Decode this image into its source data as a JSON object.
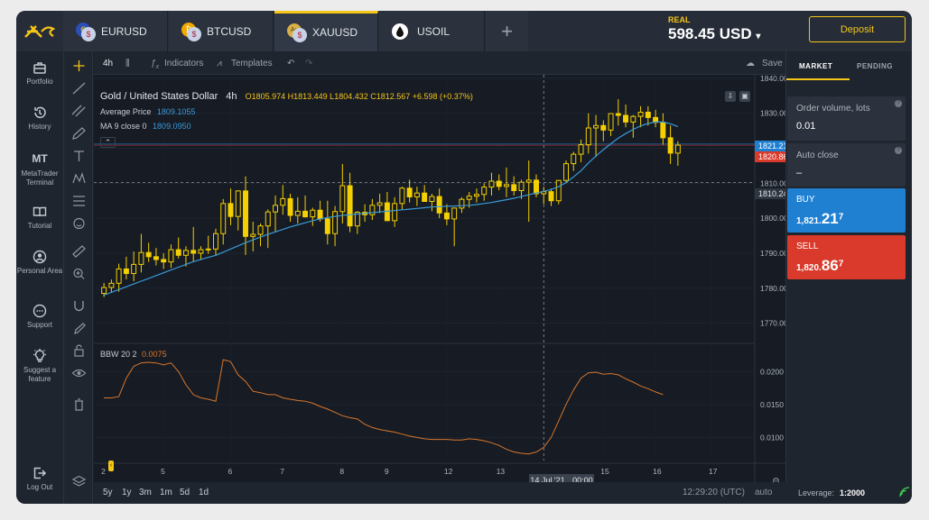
{
  "tabs": [
    {
      "symbol": "EURUSD",
      "flag1": "€",
      "flag2": "$"
    },
    {
      "symbol": "BTCUSD",
      "flag1": "₿",
      "flag2": "$"
    },
    {
      "symbol": "XAUUSD",
      "flag1": "Au",
      "flag2": "$"
    },
    {
      "symbol": "USOIL",
      "flag1": "",
      "flag2": ""
    }
  ],
  "add_tab": "+",
  "account": {
    "type": "REAL",
    "balance": "598.45 USD",
    "caret": "▾"
  },
  "deposit": "Deposit",
  "sidebar": [
    {
      "label": "Portfolio",
      "icon": "briefcase-icon"
    },
    {
      "label": "History",
      "icon": "history-icon"
    },
    {
      "label": "MetaTrader Terminal",
      "icon": "mt-icon",
      "glyph": "MT"
    },
    {
      "label": "Tutorial",
      "icon": "book-icon"
    },
    {
      "label": "Personal Area",
      "icon": "user-icon"
    },
    {
      "label": "Support",
      "icon": "chat-icon"
    },
    {
      "label": "Suggest a feature",
      "icon": "bulb-icon"
    },
    {
      "label": "Log Out",
      "icon": "logout-icon"
    }
  ],
  "toolbar": {
    "timeframe": "4h",
    "indicators": "Indicators",
    "templates": "Templates",
    "save": "Save"
  },
  "chart_info": {
    "title": "Gold / United States Dollar",
    "tf": "4h",
    "ohlc": "O1805.974 H1813.449 L1804.432 C1812.567 +6.598 (+0.37%)",
    "avg_label": "Average Price",
    "avg_value": "1809.1055",
    "ma_label": "MA 9 close 0",
    "ma_value": "1809.0950",
    "bbw_label": "BBW 20 2",
    "bbw_value": "0.0075"
  },
  "price_tags": {
    "ask": "1821.217",
    "bid": "1820.867",
    "cross": "1810.240"
  },
  "crosshair_date": "14 Jul '21",
  "crosshair_time": "00:00",
  "colors": {
    "up": "#f5d000",
    "down": "#f5d000",
    "ma": "#3a9ad9",
    "bbw": "#d9772b",
    "buy": "#1f7fd1",
    "sell": "#d93a2b",
    "accent": "#f5c518"
  },
  "chart_data": {
    "type": "line",
    "symbol": "XAUUSD",
    "timeframe": "4h",
    "price_axis": [
      1840,
      1830,
      1820,
      1810,
      1800,
      1790,
      1780,
      1770
    ],
    "price_axis_labels": [
      "1840.000",
      "1830.000",
      "1820.000",
      "1810.000",
      "1800.000",
      "1790.000",
      "1780.000",
      "1770.000"
    ],
    "bbw_axis": [
      0.02,
      0.015,
      0.01
    ],
    "bbw_axis_labels": [
      "0.0200",
      "0.0150",
      "0.0100"
    ],
    "x_labels": [
      "2",
      "5",
      "6",
      "7",
      "8",
      "9",
      "12",
      "13",
      "15",
      "16",
      "17"
    ],
    "ylim": [
      1765,
      1841
    ],
    "candles": [
      [
        1778.5,
        1781.5,
        1777.5,
        1780.2
      ],
      [
        1780.2,
        1782.5,
        1778.8,
        1781.4
      ],
      [
        1781.4,
        1787.0,
        1779.0,
        1785.5
      ],
      [
        1785.5,
        1789.0,
        1782.5,
        1784.2
      ],
      [
        1784.2,
        1790.5,
        1782.0,
        1786.8
      ],
      [
        1786.8,
        1795.5,
        1784.5,
        1790.2
      ],
      [
        1790.2,
        1793.0,
        1787.5,
        1789.0
      ],
      [
        1789.0,
        1791.5,
        1786.5,
        1788.2
      ],
      [
        1788.2,
        1790.0,
        1785.5,
        1787.5
      ],
      [
        1787.5,
        1792.5,
        1785.8,
        1791.0
      ],
      [
        1791.0,
        1794.5,
        1788.5,
        1789.4
      ],
      [
        1789.4,
        1792.0,
        1786.2,
        1790.8
      ],
      [
        1790.8,
        1797.5,
        1787.5,
        1790.0
      ],
      [
        1790.0,
        1792.0,
        1788.0,
        1791.0
      ],
      [
        1791.0,
        1795.0,
        1789.8,
        1791.2
      ],
      [
        1791.2,
        1797.0,
        1789.5,
        1795.6
      ],
      [
        1795.6,
        1805.5,
        1792.5,
        1804.2
      ],
      [
        1804.2,
        1808.5,
        1798.0,
        1800.5
      ],
      [
        1800.5,
        1808.0,
        1796.5,
        1807.8
      ],
      [
        1807.8,
        1812.0,
        1789.5,
        1794.8
      ],
      [
        1794.8,
        1799.0,
        1790.5,
        1795.4
      ],
      [
        1795.4,
        1798.5,
        1792.0,
        1797.8
      ],
      [
        1797.8,
        1802.5,
        1791.5,
        1801.8
      ],
      [
        1801.8,
        1806.5,
        1796.0,
        1803.7
      ],
      [
        1803.7,
        1809.5,
        1801.0,
        1805.6
      ],
      [
        1805.6,
        1807.0,
        1799.0,
        1800.8
      ],
      [
        1800.8,
        1806.0,
        1798.5,
        1802.0
      ],
      [
        1802.0,
        1806.5,
        1800.2,
        1800.4
      ],
      [
        1800.4,
        1803.0,
        1797.8,
        1802.3
      ],
      [
        1802.3,
        1805.0,
        1799.0,
        1799.8
      ],
      [
        1799.8,
        1805.0,
        1792.5,
        1795.6
      ],
      [
        1795.6,
        1803.5,
        1792.0,
        1801.9
      ],
      [
        1801.9,
        1815.5,
        1798.5,
        1809.3
      ],
      [
        1809.3,
        1813.0,
        1796.0,
        1797.8
      ],
      [
        1797.8,
        1802.0,
        1795.5,
        1801.7
      ],
      [
        1801.7,
        1804.0,
        1799.0,
        1801.0
      ],
      [
        1801.0,
        1805.5,
        1799.5,
        1803.7
      ],
      [
        1803.7,
        1807.0,
        1801.5,
        1804.4
      ],
      [
        1804.4,
        1807.5,
        1801.0,
        1799.3
      ],
      [
        1799.3,
        1806.0,
        1797.5,
        1804.2
      ],
      [
        1804.2,
        1809.0,
        1802.5,
        1808.6
      ],
      [
        1808.6,
        1811.0,
        1804.5,
        1806.1
      ],
      [
        1806.1,
        1809.0,
        1803.5,
        1807.2
      ],
      [
        1807.2,
        1809.5,
        1805.0,
        1804.8
      ],
      [
        1804.8,
        1807.0,
        1802.0,
        1806.2
      ],
      [
        1806.2,
        1808.5,
        1800.0,
        1801.5
      ],
      [
        1801.5,
        1804.0,
        1798.0,
        1799.8
      ],
      [
        1799.8,
        1803.0,
        1792.0,
        1802.9
      ],
      [
        1802.9,
        1806.0,
        1801.5,
        1805.4
      ],
      [
        1805.4,
        1807.5,
        1803.0,
        1806.3
      ],
      [
        1806.3,
        1808.5,
        1804.5,
        1806.8
      ],
      [
        1806.8,
        1810.0,
        1805.0,
        1808.9
      ],
      [
        1808.9,
        1813.0,
        1806.5,
        1810.6
      ],
      [
        1810.6,
        1812.5,
        1808.0,
        1809.1
      ],
      [
        1809.1,
        1814.5,
        1806.0,
        1809.6
      ],
      [
        1809.6,
        1812.0,
        1806.5,
        1807.9
      ],
      [
        1807.9,
        1811.0,
        1805.5,
        1810.3
      ],
      [
        1810.3,
        1816.5,
        1799.0,
        1810.9
      ],
      [
        1810.9,
        1812.5,
        1806.0,
        1807.0
      ],
      [
        1807.0,
        1809.0,
        1804.0,
        1807.6
      ],
      [
        1807.6,
        1808.5,
        1803.5,
        1805.0
      ],
      [
        1805.0,
        1809.5,
        1804.0,
        1810.8
      ],
      [
        1810.8,
        1816.5,
        1810.0,
        1815.6
      ],
      [
        1815.6,
        1819.0,
        1813.5,
        1818.3
      ],
      [
        1818.3,
        1822.5,
        1816.0,
        1821.0
      ],
      [
        1821.0,
        1830.0,
        1818.5,
        1825.8
      ],
      [
        1825.8,
        1829.5,
        1817.5,
        1826.5
      ],
      [
        1826.5,
        1828.0,
        1822.0,
        1825.2
      ],
      [
        1825.2,
        1830.0,
        1823.5,
        1829.9
      ],
      [
        1829.9,
        1834.0,
        1826.5,
        1829.4
      ],
      [
        1829.4,
        1832.5,
        1826.0,
        1827.5
      ],
      [
        1827.5,
        1829.5,
        1823.0,
        1829.1
      ],
      [
        1829.1,
        1832.0,
        1826.0,
        1830.3
      ],
      [
        1830.3,
        1832.0,
        1826.5,
        1828.8
      ],
      [
        1828.8,
        1831.0,
        1826.0,
        1827.4
      ],
      [
        1827.4,
        1830.0,
        1821.0,
        1823.0
      ],
      [
        1823.0,
        1826.5,
        1815.5,
        1818.6
      ],
      [
        1818.6,
        1822.0,
        1815.0,
        1820.9
      ]
    ],
    "ma": [
      1778,
      1778.8,
      1779.6,
      1780.4,
      1781.2,
      1782.0,
      1782.8,
      1783.6,
      1784.4,
      1785.2,
      1786.0,
      1786.8,
      1787.6,
      1788.2,
      1788.8,
      1789.4,
      1790.3,
      1791.2,
      1792.1,
      1793.0,
      1793.8,
      1794.6,
      1795.4,
      1796.1,
      1796.8,
      1797.5,
      1798.1,
      1798.7,
      1799.3,
      1799.8,
      1800.2,
      1800.5,
      1800.8,
      1801.0,
      1801.2,
      1801.4,
      1801.6,
      1801.8,
      1802.0,
      1802.2,
      1802.4,
      1802.6,
      1802.8,
      1803.0,
      1803.2,
      1803.3,
      1803.4,
      1803.5,
      1803.6,
      1803.7,
      1803.9,
      1804.2,
      1804.5,
      1804.9,
      1805.3,
      1805.7,
      1806.2,
      1806.7,
      1807.2,
      1807.7,
      1808.2,
      1809.0,
      1810.2,
      1811.8,
      1813.6,
      1815.8,
      1817.8,
      1819.6,
      1821.3,
      1822.9,
      1824.2,
      1825.4,
      1826.4,
      1827.1,
      1827.5,
      1827.5,
      1827.0,
      1826.2
    ],
    "bbw": [
      0.016,
      0.016,
      0.0162,
      0.019,
      0.0208,
      0.0213,
      0.0214,
      0.0213,
      0.021,
      0.0213,
      0.02,
      0.018,
      0.0165,
      0.016,
      0.0158,
      0.0155,
      0.0218,
      0.0215,
      0.0195,
      0.0185,
      0.017,
      0.0168,
      0.0165,
      0.0165,
      0.016,
      0.0158,
      0.0156,
      0.0155,
      0.0152,
      0.0147,
      0.0143,
      0.0138,
      0.0133,
      0.013,
      0.0128,
      0.012,
      0.0115,
      0.0112,
      0.011,
      0.0108,
      0.0105,
      0.0102,
      0.01,
      0.0098,
      0.0097,
      0.0097,
      0.0097,
      0.0096,
      0.0096,
      0.0098,
      0.0097,
      0.0095,
      0.0092,
      0.0088,
      0.0082,
      0.0078,
      0.0076,
      0.0075,
      0.0078,
      0.0085,
      0.01,
      0.0125,
      0.015,
      0.0172,
      0.019,
      0.0198,
      0.0199,
      0.0196,
      0.0197,
      0.0195,
      0.0189,
      0.0184,
      0.0178,
      0.0174,
      0.0169,
      0.0165
    ]
  },
  "ranges": [
    "5y",
    "1y",
    "3m",
    "1m",
    "5d",
    "1d"
  ],
  "clock": "12:29:20 (UTC)",
  "auto_label": "auto",
  "leverage_label": "Leverage:",
  "leverage_value": "1:2000",
  "panel": {
    "tab_market": "MARKET",
    "tab_pending": "PENDING",
    "order_label": "Order volume, lots",
    "order_value": "0.01",
    "auto_close_label": "Auto close",
    "auto_close_value": "–",
    "buy_label": "BUY",
    "buy_small": "1,821.",
    "buy_big": "21",
    "buy_sup": "7",
    "sell_label": "SELL",
    "sell_small": "1,820.",
    "sell_big": "86",
    "sell_sup": "7"
  }
}
